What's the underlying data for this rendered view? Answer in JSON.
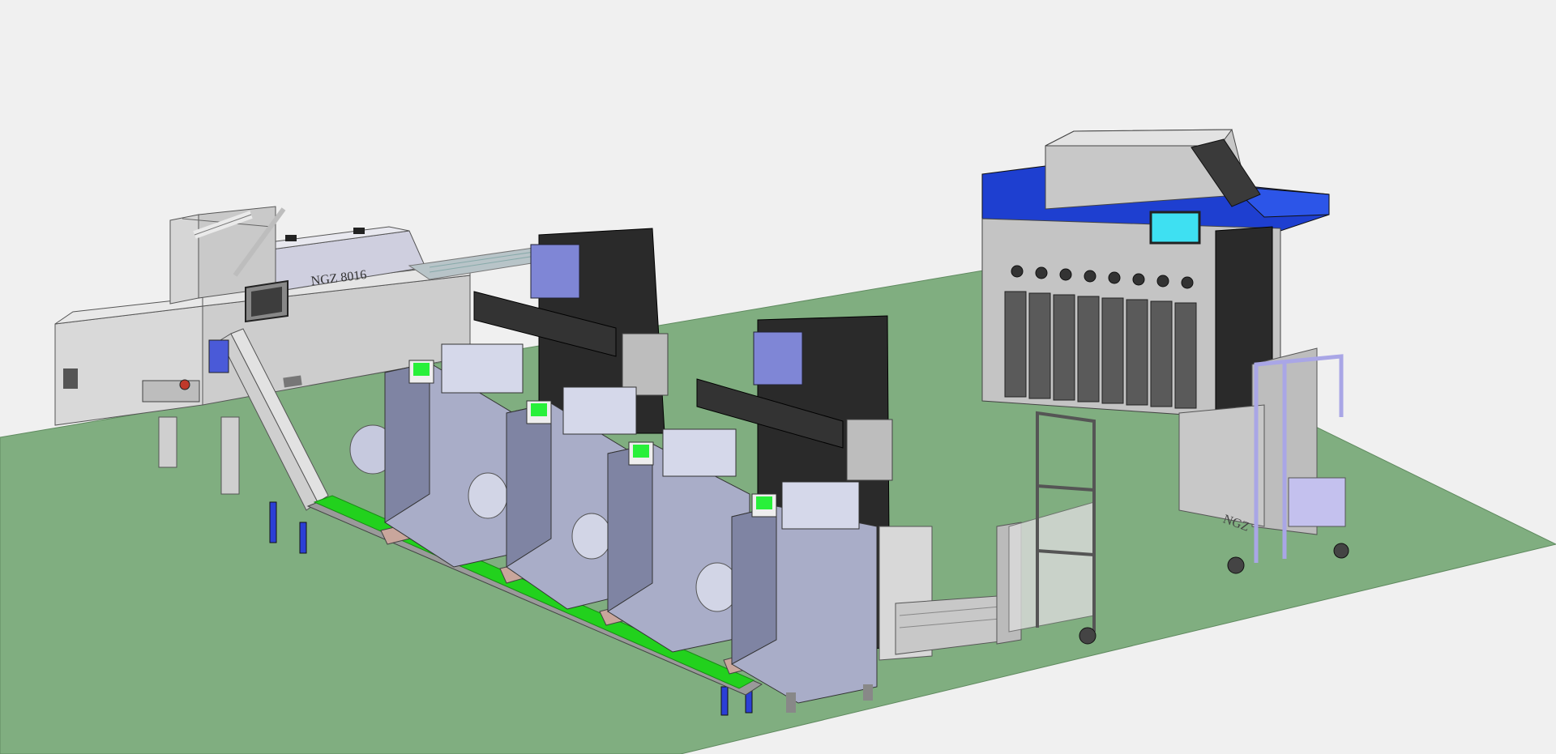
{
  "scene": {
    "colors": {
      "background": "#f0f0f0",
      "floor": "#80ae80",
      "machine_light": "#dcdcdc",
      "machine_mid": "#bdbdbd",
      "machine_dark": "#2a2a2a",
      "hopper_body": "#a9adc8",
      "hopper_shade": "#7f84a3",
      "blue_panel": "#1e3fd0",
      "purple_head": "#7f86d6",
      "conveyor_green": "#22d11d",
      "screen_green": "#28f03a",
      "screen_cyan": "#3ee0f2",
      "bucket_pink": "#c9a69c",
      "frame_lilac": "#a9a6e6"
    }
  },
  "labels": {
    "slicer_plate": "NGZ 8016",
    "cart_plate": "NGZ"
  }
}
